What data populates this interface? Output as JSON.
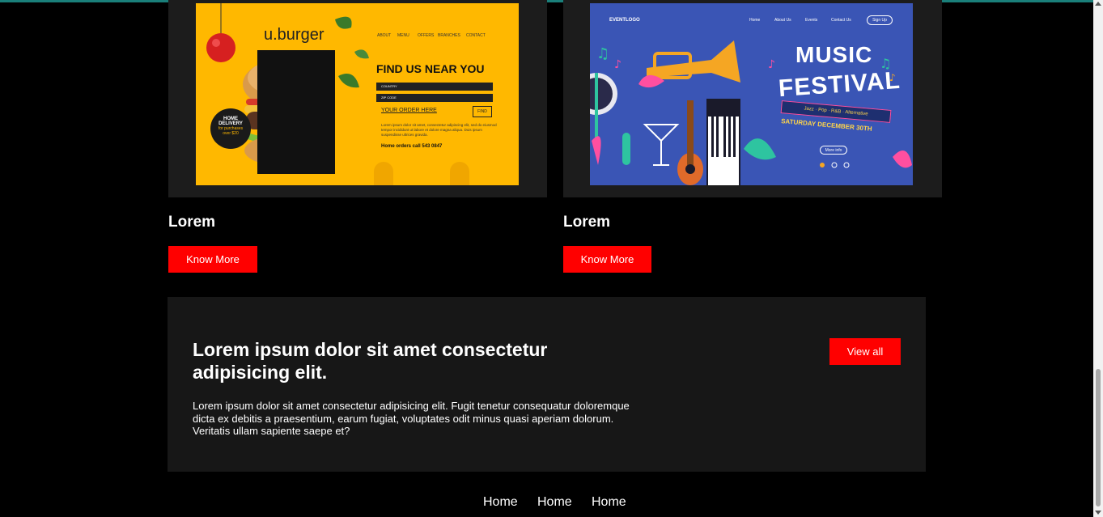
{
  "cards": [
    {
      "title": "Lorem",
      "button": "Know More",
      "image": {
        "logo": "u.burger",
        "nav": [
          "ABOUT",
          "MENU",
          "OFFERS",
          "BRANCHES",
          "CONTACT"
        ],
        "heading": "FIND US NEAR YOU",
        "select_country": "COUNTRY",
        "select_zip": "ZIP CODE",
        "order_link": "YOUR ORDER HERE",
        "find_button": "FIND",
        "paragraph": "Lorem ipsum dolor sit amet, consectetur adipiscing elit, sed do eiusmod tempor incididunt ut labore et dolore magna aliqua. Duis ipsum suspendisse ultrices gravida.",
        "phone": "Home orders call 543 0847",
        "badge_line1": "HOME",
        "badge_line2": "DELIVERY",
        "badge_line3": "for purchases",
        "badge_line4": "over $20"
      }
    },
    {
      "title": "Lorem",
      "button": "Know More",
      "image": {
        "logo": "EVENTLOGO",
        "nav": [
          "Home",
          "About Us",
          "Events",
          "Contact Us"
        ],
        "signup": "Sign Up",
        "title_line1": "MUSIC",
        "title_line2": "FESTIVAL",
        "genres": "Jazz · Pop · R&B · Alternative",
        "date": "SATURDAY DECEMBER 30TH",
        "more_info": "More info"
      }
    }
  ],
  "promo": {
    "title": "Lorem ipsum dolor sit amet consectetur adipisicing elit.",
    "text": "Lorem ipsum dolor sit amet consectetur adipisicing elit. Fugit tenetur consequatur doloremque dicta ex debitis a praesentium, earum fugiat, voluptates odit minus quasi aperiam dolorum. Veritatis ullam sapiente saepe et?",
    "button": "View all"
  },
  "footer": {
    "links": [
      "Home",
      "Home",
      "Home"
    ]
  },
  "colors": {
    "accent": "#ff0000",
    "background": "#000000",
    "panel": "#171717"
  }
}
